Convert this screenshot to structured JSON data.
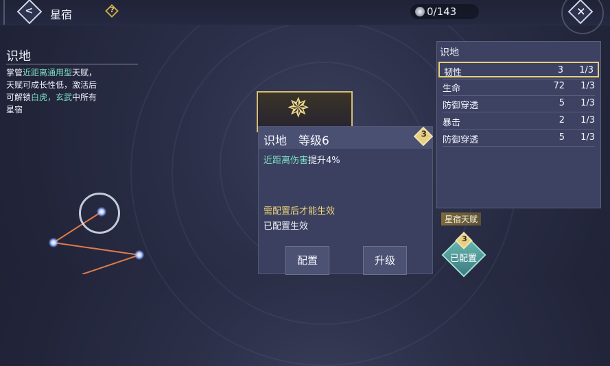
{
  "header": {
    "back_icon": "arrow-left-icon",
    "title": "星宿",
    "help_icon": "question-icon",
    "counter": "0/143",
    "close_icon": "close-x-icon"
  },
  "info": {
    "title": "识地",
    "desc_prefix": "掌管",
    "desc_highlight1": "近距离通用型",
    "desc_mid": "天赋，天赋可成长性低，激活后可解锁",
    "desc_highlight2": "白虎，玄武",
    "desc_suffix": "中所有星宿"
  },
  "popup": {
    "title": "识地　等级6",
    "badge": "3",
    "effect_highlight": "近距离伤害",
    "effect_text": "提升4%",
    "requirement": "需配置后才能生效",
    "status": "已配置生效",
    "config_button": "配置",
    "upgrade_button": "升级"
  },
  "stats": {
    "title": "识地",
    "rows": [
      {
        "name": "韧性",
        "value": "3",
        "progress": "1/3",
        "selected": true
      },
      {
        "name": "生命",
        "value": "72",
        "progress": "1/3",
        "selected": false
      },
      {
        "name": "防御穿透",
        "value": "5",
        "progress": "1/3",
        "selected": false
      },
      {
        "name": "暴击",
        "value": "2",
        "progress": "1/3",
        "selected": false
      },
      {
        "name": "防御穿透",
        "value": "5",
        "progress": "1/3",
        "selected": false
      }
    ]
  },
  "talent": {
    "label": "星宿天赋",
    "badge": "3",
    "status": "已配置"
  },
  "colors": {
    "accent_gold": "#e6d07a",
    "highlight_green": "#7ee0c4",
    "requirement_yellow": "#f2d77a",
    "panel_bg": "#3d4263"
  }
}
